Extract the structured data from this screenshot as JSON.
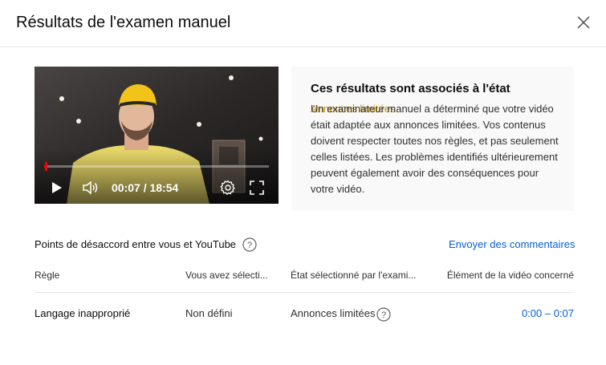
{
  "dialog": {
    "title": "Résultats de l'examen manuel"
  },
  "player": {
    "time_current": "00:07",
    "time_separator": " / ",
    "time_total": "18:54",
    "progress": 0.006
  },
  "info": {
    "heading": "Ces résultats sont associés à l'état",
    "status_label": "Annonces limitées",
    "body": "Un examinateur manuel a déterminé que votre vidéo était adaptée aux annonces limitées. Vos contenus doivent respecter toutes nos règles, et pas seulement celles listées. Les problèmes identifiés ultérieurement peuvent également avoir des conséquences pour votre vidéo.",
    "status_color": "#c79100"
  },
  "disagreement": {
    "label": "Points de désaccord entre vous et YouTube",
    "feedback_link": "Envoyer des commentaires"
  },
  "table": {
    "headers": [
      "Règle",
      "Vous avez sélecti...",
      "État sélectionné par l'exami...",
      "Élément de la vidéo concerné"
    ],
    "rows": [
      {
        "rule": "Langage inapproprié",
        "you_selected": "Non défini",
        "reviewer_state": "Annonces limitées",
        "segment": "0:00 – 0:07"
      }
    ]
  },
  "colors": {
    "link": "#065fd4",
    "progress": "#ff0000"
  }
}
